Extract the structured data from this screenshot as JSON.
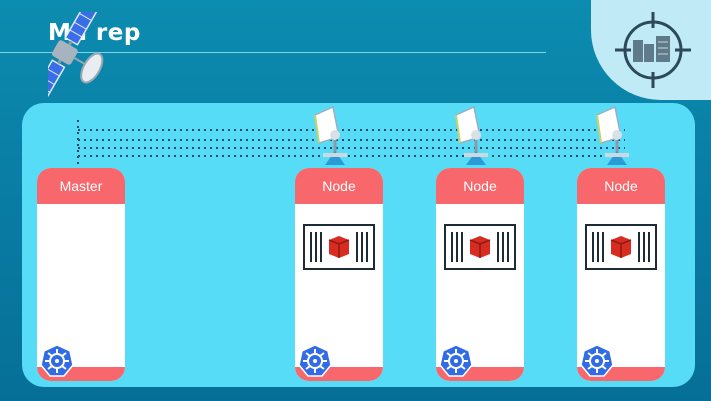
{
  "title": "Ma rep",
  "nodes": [
    {
      "id": "master",
      "label": "Master",
      "has_redis": false
    },
    {
      "id": "node1",
      "label": "Node",
      "has_redis": true
    },
    {
      "id": "node2",
      "label": "Node",
      "has_redis": true
    },
    {
      "id": "node3",
      "label": "Node",
      "has_redis": true
    }
  ],
  "icons": {
    "satellite": "satellite-icon",
    "dish": "satellite-dish-icon",
    "kubernetes": "kubernetes-icon",
    "redis": "redis-icon",
    "server": "server-rack-icon"
  },
  "colors": {
    "background": "#0a7fa6",
    "panel": "#56dcf7",
    "node_accent": "#f7676b",
    "kubernetes": "#326ce5",
    "redis": "#d82c20"
  }
}
